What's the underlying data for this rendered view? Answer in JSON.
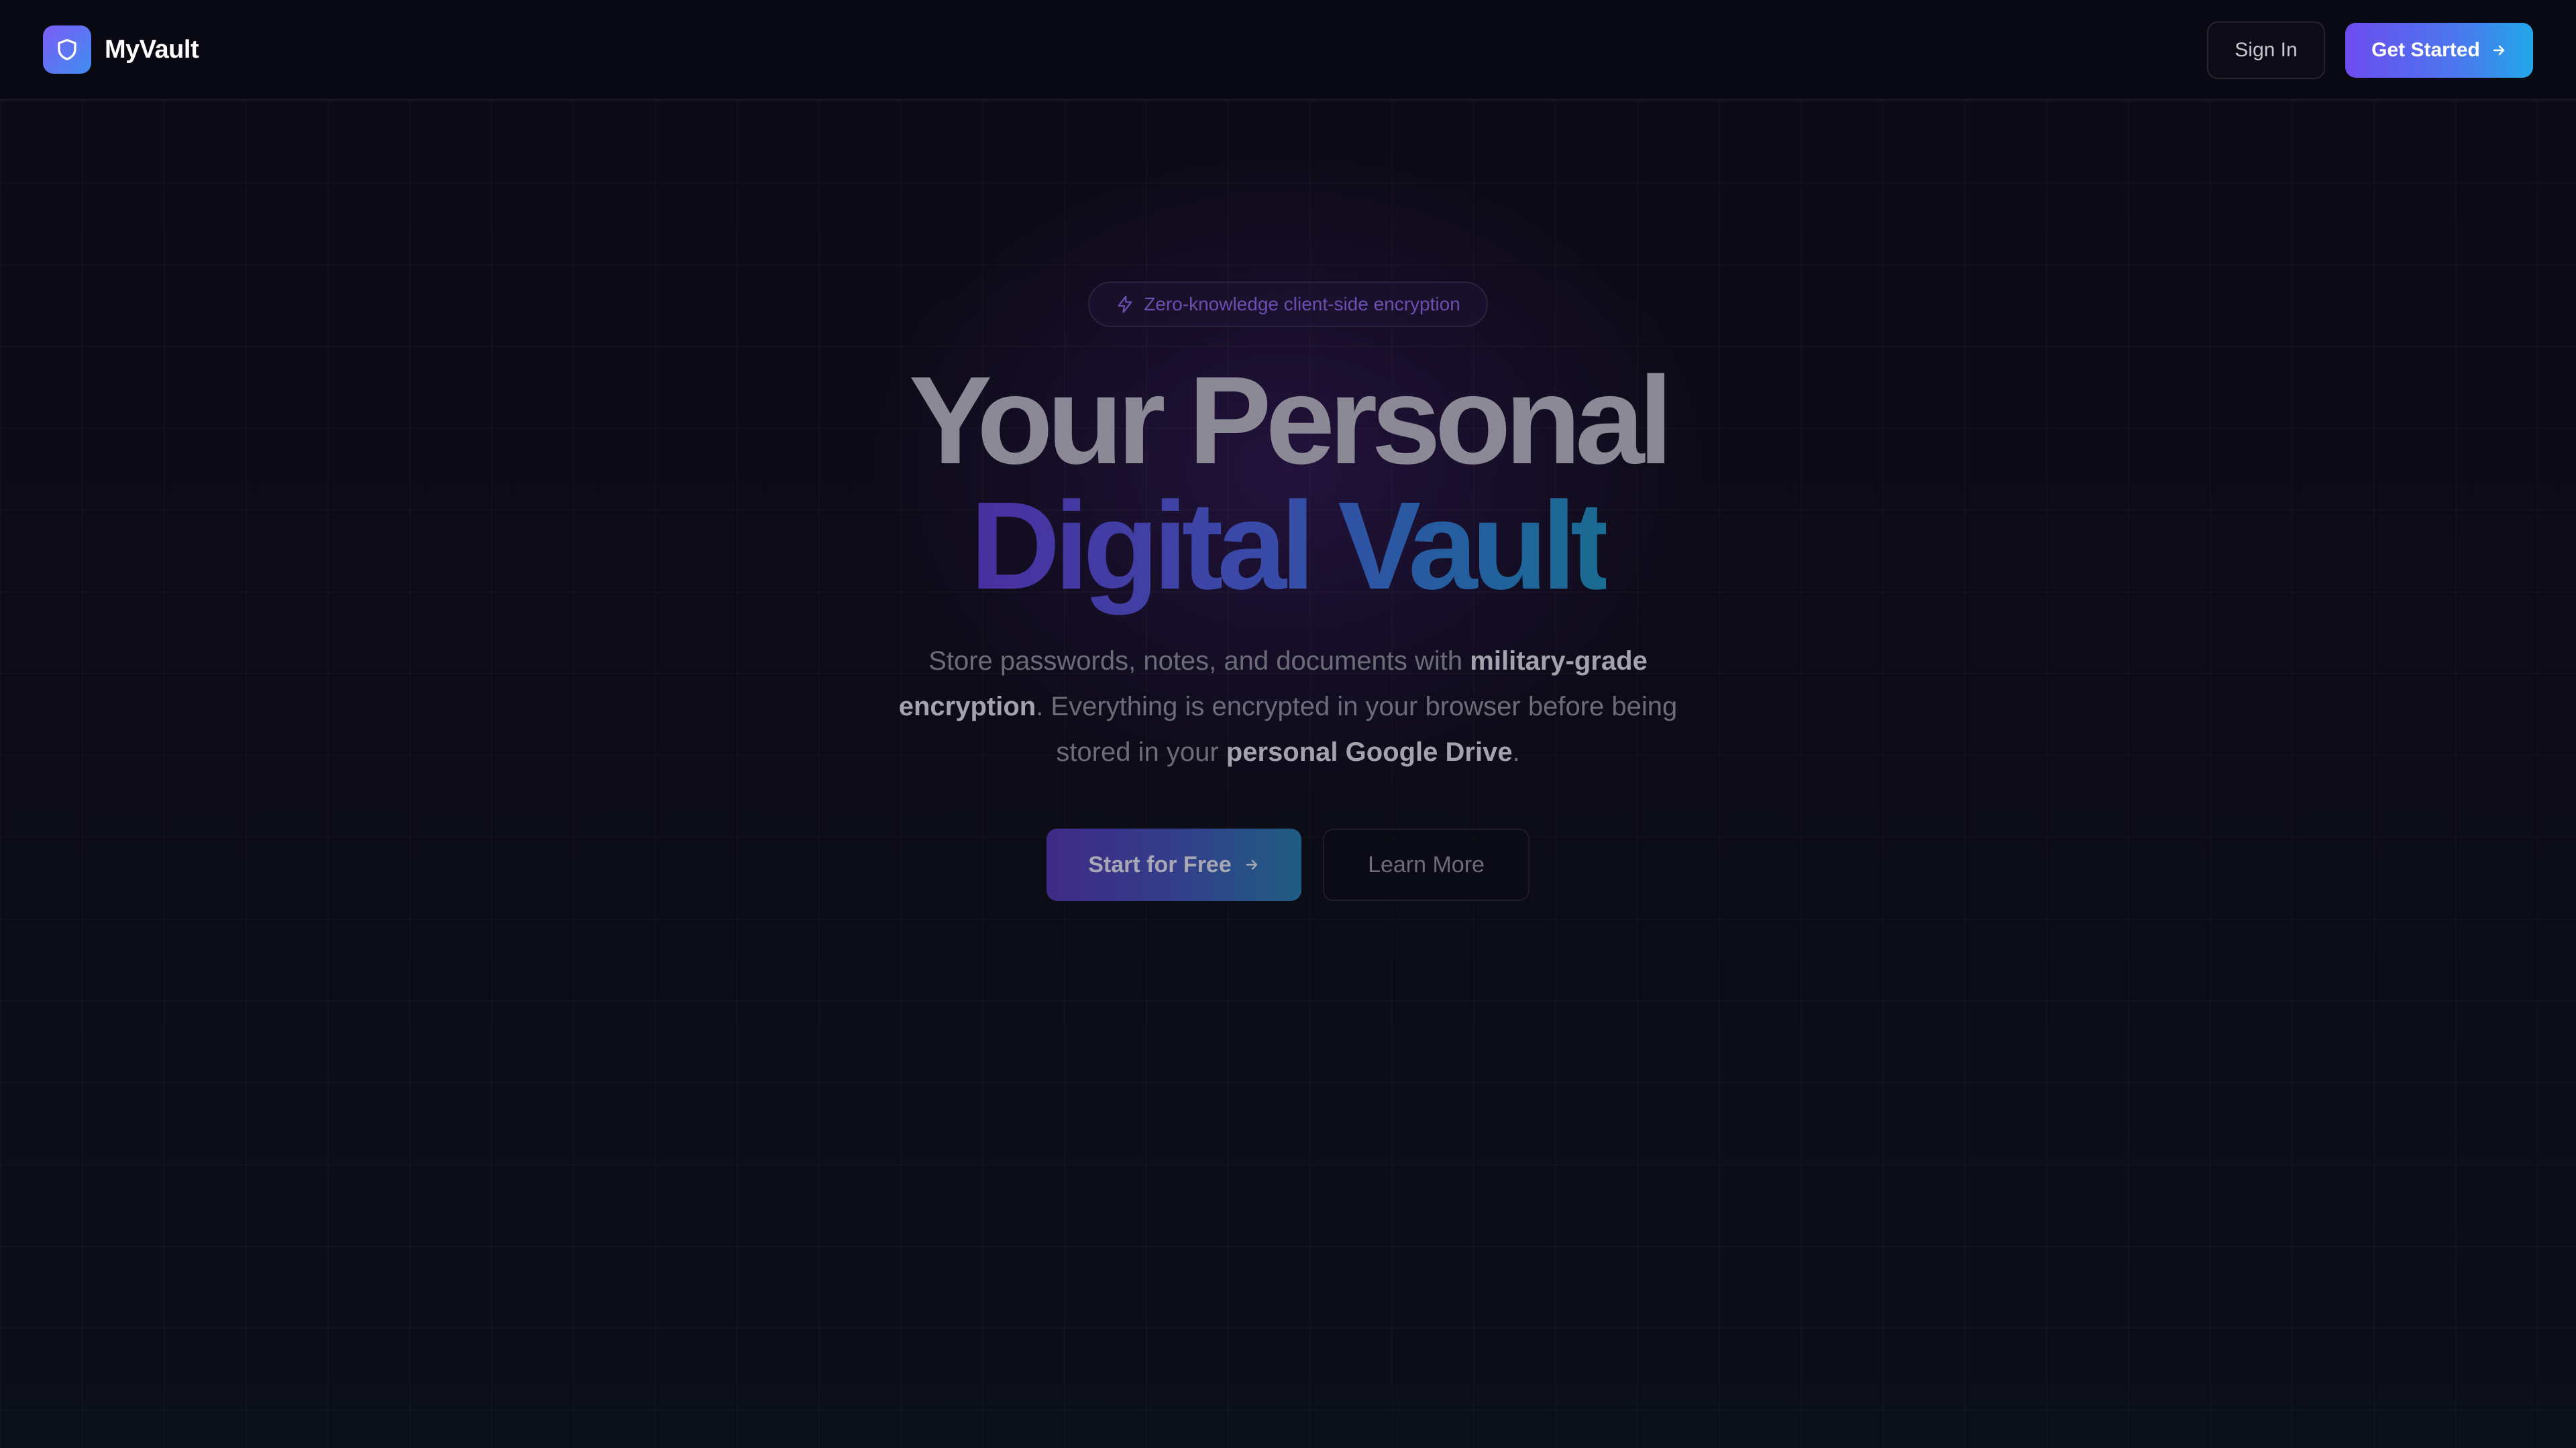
{
  "header": {
    "brand": "MyVault",
    "sign_in": "Sign In",
    "get_started": "Get Started"
  },
  "hero": {
    "badge": "Zero-knowledge client-side encryption",
    "title_line1": "Your Personal",
    "title_line2": "Digital Vault",
    "subtitle": {
      "part1": "Store passwords, notes, and documents with ",
      "bold1": "military-grade encryption",
      "part2": ". Everything is encrypted in your browser before being stored in your ",
      "bold2": "personal Google Drive",
      "part3": "."
    },
    "cta_primary": "Start for Free",
    "cta_secondary": "Learn More"
  },
  "colors": {
    "background": "#0b0a14",
    "accent_purple": "#6d4cf0",
    "accent_blue": "#22a7e8"
  },
  "icons": {
    "logo": "shield-icon",
    "badge": "lightning-icon",
    "arrow": "arrow-right-icon"
  }
}
